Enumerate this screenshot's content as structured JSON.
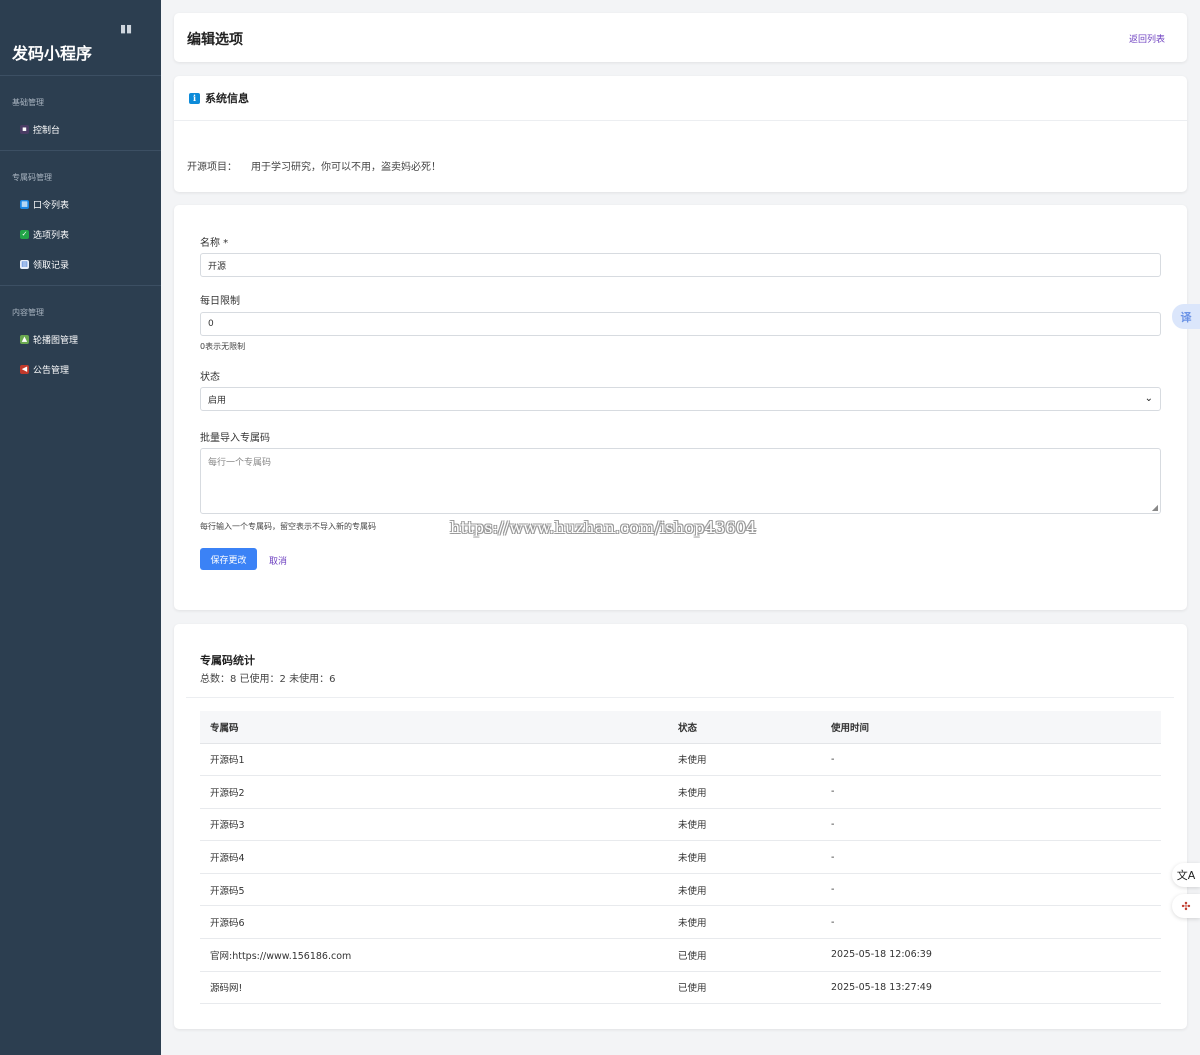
{
  "sidebar": {
    "title": "发码小程序",
    "collapse_icon": "▮▮",
    "sections": [
      {
        "label": "基础管理",
        "items": [
          {
            "label": "控制台",
            "icon": "dashboard-icon"
          }
        ]
      },
      {
        "label": "专属码管理",
        "items": [
          {
            "label": "口令列表",
            "icon": "grid-icon"
          },
          {
            "label": "选项列表",
            "icon": "checkbox-icon"
          },
          {
            "label": "领取记录",
            "icon": "calendar-icon"
          }
        ]
      },
      {
        "label": "内容管理",
        "items": [
          {
            "label": "轮播图管理",
            "icon": "image-icon"
          },
          {
            "label": "公告管理",
            "icon": "megaphone-icon"
          }
        ]
      }
    ]
  },
  "header": {
    "title": "编辑选项",
    "back_link": "返回列表"
  },
  "system_info": {
    "title": "系统信息",
    "icon": "info-icon",
    "label": "开源项目：",
    "value": "用于学习研究，你可以不用，盗卖妈必死！"
  },
  "form": {
    "name_label": "名称 *",
    "name_value": "开源",
    "daily_limit_label": "每日限制",
    "daily_limit_value": "0",
    "daily_limit_help": "0表示无限制",
    "status_label": "状态",
    "status_value": "启用",
    "import_label": "批量导入专属码",
    "import_placeholder": "每行一个专属码",
    "import_help": "每行输入一个专属码，留空表示不导入新的专属码",
    "save_label": "保存更改",
    "cancel_label": "取消"
  },
  "stats": {
    "title": "专属码统计",
    "summary": "总数：8 已使用：2 未使用：6",
    "columns": [
      "专属码",
      "状态",
      "使用时间"
    ],
    "rows": [
      [
        "开源码1",
        "未使用",
        "-"
      ],
      [
        "开源码2",
        "未使用",
        "-"
      ],
      [
        "开源码3",
        "未使用",
        "-"
      ],
      [
        "开源码4",
        "未使用",
        "-"
      ],
      [
        "开源码5",
        "未使用",
        "-"
      ],
      [
        "开源码6",
        "未使用",
        "-"
      ],
      [
        "官网:https://www.156186.com",
        "已使用",
        "2025-05-18 12:06:39"
      ],
      [
        "源码网!",
        "已使用",
        "2025-05-18 13:27:49"
      ]
    ]
  },
  "watermark": "https://www.huzhan.com/ishop43604",
  "floating": {
    "translate_label": "译",
    "translate2_icon": "文A",
    "extension_icon": "✣"
  },
  "colors": {
    "sidebar_bg": "#2c3e50",
    "primary": "#3b82f6",
    "link": "#6f42c1",
    "info": "#0d8bd9"
  }
}
